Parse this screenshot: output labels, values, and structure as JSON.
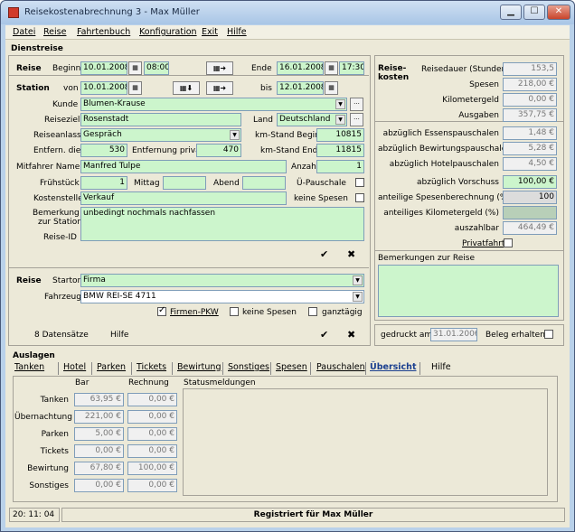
{
  "window": {
    "title": "Reisekostenabrechnung 3 - Max Müller",
    "min": "▁",
    "max": "☐",
    "close": "✕"
  },
  "menu": [
    "Datei",
    "Reise",
    "Fahrtenbuch",
    "Konfiguration",
    "Exit",
    "Hilfe"
  ],
  "dienstreise": {
    "section": "Dienstreise",
    "reise_label": "Reise",
    "beginn_label": "Beginn",
    "beginn_date": "10.01.2008",
    "beginn_time": "08:00:",
    "ende_label": "Ende",
    "ende_date": "16.01.2008",
    "ende_time": "17:30:",
    "station_label": "Station",
    "von_label": "von",
    "von_date": "10.01.2008",
    "bis_label": "bis",
    "bis_date": "12.01.2008",
    "kunde_label": "Kunde",
    "kunde": "Blumen-Krause",
    "reiseziel_label": "Reiseziel",
    "reiseziel": "Rosenstadt",
    "land_label": "Land",
    "land": "Deutschland",
    "reiseanlass_label": "Reiseanlass",
    "reiseanlass": "Gespräch",
    "kmbeginn_label": "km-Stand Beginn",
    "kmbeginn": "10815",
    "entfdienstl_label": "Entfern. dienstl.",
    "entfdienstl": "530",
    "entfprivat_label": "Entfernung privat",
    "entfprivat": "470",
    "kmende_label": "km-Stand Ende",
    "kmende": "11815",
    "mitfahrer_label": "Mitfahrer Namen",
    "mitfahrer": "Manfred Tulpe",
    "anzahl_label": "Anzahl",
    "anzahl": "1",
    "fruehstueck_label": "Frühstück",
    "fruehstueck": "1",
    "mittag_label": "Mittag",
    "abend_label": "Abend",
    "pauschale_label": "Ü-Pauschale",
    "kostenstelle_label": "Kostenstelle",
    "kostenstelle": "Verkauf",
    "keinespesen_label": "keine Spesen",
    "bemerkung_label1": "Bemerkung",
    "bemerkung_label2": "zur Station",
    "bemerkung": "unbedingt nochmals nachfassen",
    "reiseid_label": "Reise-ID",
    "ok": "✔",
    "cancel": "✖"
  },
  "reise": {
    "label": "Reise",
    "startort_label": "Startort",
    "startort": "Firma",
    "fahrzeug_label": "Fahrzeug",
    "fahrzeug": "BMW REI-SE 4711",
    "firmenpkw_label": "Firmen-PKW",
    "keinespesen_label": "keine Spesen",
    "ganztaegig_label": "ganztägig",
    "datensaetze": "8 Datensätze",
    "hilfe": "Hilfe"
  },
  "kosten": {
    "title1": "Reise-",
    "title2": "kosten",
    "rows": [
      {
        "label": "Reisedauer (Stunden)",
        "value": "153,5"
      },
      {
        "label": "Spesen",
        "value": "218,00 €"
      },
      {
        "label": "Kilometergeld",
        "value": "0,00 €"
      },
      {
        "label": "Ausgaben",
        "value": "357,75 €"
      },
      {
        "label": "abzüglich Essenspauschalen",
        "value": "1,48 €"
      },
      {
        "label": "abzüglich Bewirtungspauschalen",
        "value": "5,28 €"
      },
      {
        "label": "abzüglich Hotelpauschalen",
        "value": "4,50 €"
      },
      {
        "label": "abzüglich Vorschuss",
        "value": "100,00 €"
      },
      {
        "label": "anteilige Spesenberechnung (%)",
        "value": "100"
      },
      {
        "label": "anteiliges Kilometergeld (%)",
        "value": ""
      },
      {
        "label": "auszahlbar",
        "value": "464,49 €"
      }
    ],
    "privatfahrt_label": "Privatfahrt",
    "bemerkungen_label": "Bemerkungen zur Reise",
    "gedruckt_label": "gedruckt am",
    "gedruckt": "31.01.2006",
    "beleg_label": "Beleg erhalten"
  },
  "auslagen": {
    "section": "Auslagen",
    "tabs": [
      "Tanken",
      "Hotel",
      "Parken",
      "Tickets",
      "Bewirtung",
      "Sonstiges",
      "Spesen",
      "Pauschalen",
      "Übersicht",
      "Hilfe"
    ],
    "col_bar": "Bar",
    "col_rechnung": "Rechnung",
    "col_status": "Statusmeldungen",
    "rows": [
      {
        "label": "Tanken",
        "bar": "63,95 €",
        "rechnung": "0,00 €"
      },
      {
        "label": "Übernachtung",
        "bar": "221,00 €",
        "rechnung": "0,00 €"
      },
      {
        "label": "Parken",
        "bar": "5,00 €",
        "rechnung": "0,00 €"
      },
      {
        "label": "Tickets",
        "bar": "0,00 €",
        "rechnung": "0,00 €"
      },
      {
        "label": "Bewirtung",
        "bar": "67,80 €",
        "rechnung": "100,00 €"
      },
      {
        "label": "Sonstiges",
        "bar": "0,00 €",
        "rechnung": "0,00 €"
      }
    ]
  },
  "status": {
    "time": "20: 11: 04",
    "registered": "Registriert für Max Müller"
  }
}
